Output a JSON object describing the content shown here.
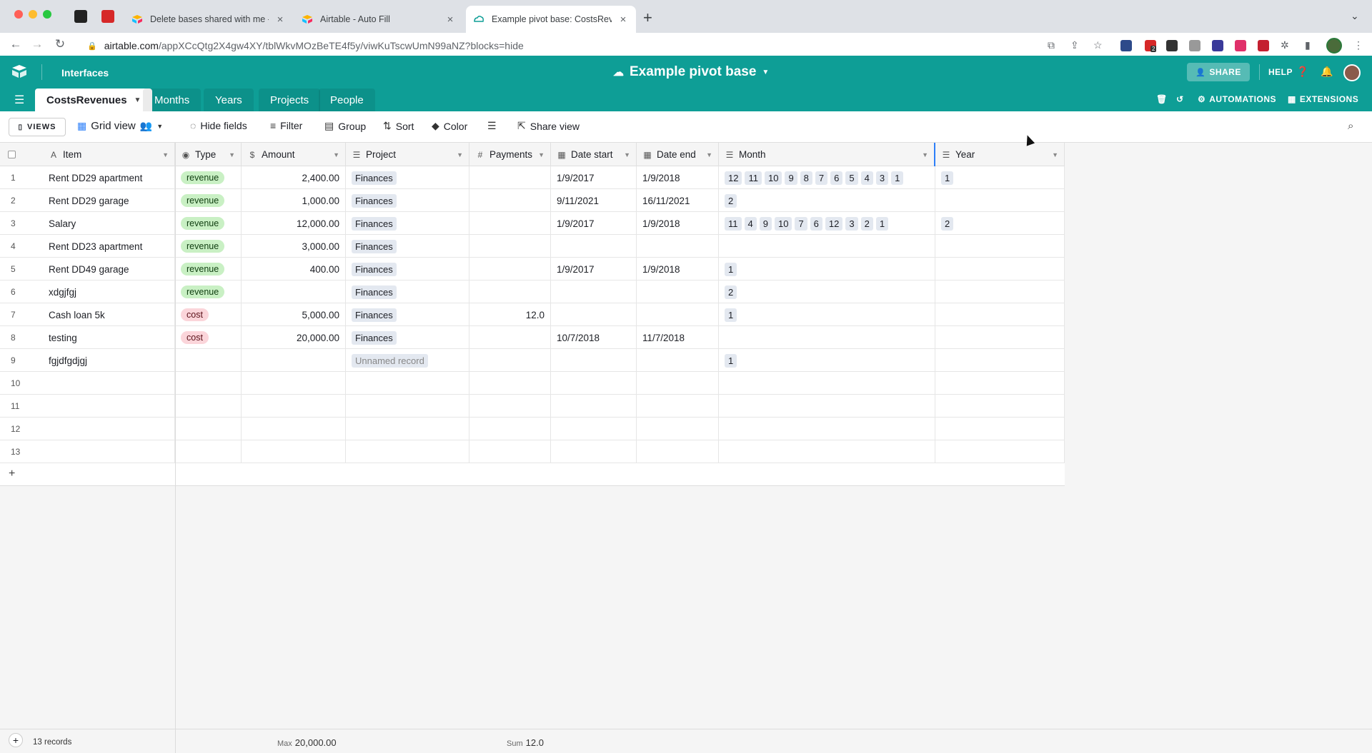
{
  "browser": {
    "tabs": [
      {
        "title": "Delete bases shared with me -",
        "active": false
      },
      {
        "title": "Airtable - Auto Fill",
        "active": false
      },
      {
        "title": "Example pivot base: CostsReve",
        "active": true
      }
    ],
    "url_host": "airtable.com",
    "url_path": "/appXCcQtg2X4gw4XY/tblWkvMOzBeTE4f5y/viwKuTscwUmN99aNZ?blocks=hide",
    "ext_badge": "2"
  },
  "header": {
    "interfaces": "Interfaces",
    "base_title": "Example pivot base",
    "share": "SHARE",
    "help": "HELP"
  },
  "tables": [
    "CostsRevenues",
    "Months",
    "Years",
    "Projects",
    "People"
  ],
  "tablebar_right": {
    "automations": "AUTOMATIONS",
    "extensions": "EXTENSIONS"
  },
  "toolbar": {
    "views": "VIEWS",
    "grid_view": "Grid view",
    "hide_fields": "Hide fields",
    "filter": "Filter",
    "group": "Group",
    "sort": "Sort",
    "color": "Color",
    "share_view": "Share view"
  },
  "columns": {
    "item": "Item",
    "type": "Type",
    "amount": "Amount",
    "project": "Project",
    "payments": "Payments",
    "date_start": "Date start",
    "date_end": "Date end",
    "month": "Month",
    "year": "Year"
  },
  "rows": [
    {
      "n": "1",
      "item": "Rent DD29 apartment",
      "type": "revenue",
      "amount": "2,400.00",
      "project": "Finances",
      "payments": "",
      "date_start": "1/9/2017",
      "date_end": "1/9/2018",
      "month": [
        "12",
        "11",
        "10",
        "9",
        "8",
        "7",
        "6",
        "5",
        "4",
        "3",
        "1"
      ],
      "year": [
        "1"
      ]
    },
    {
      "n": "2",
      "item": "Rent DD29 garage",
      "type": "revenue",
      "amount": "1,000.00",
      "project": "Finances",
      "payments": "",
      "date_start": "9/11/2021",
      "date_end": "16/11/2021",
      "month": [
        "2"
      ],
      "year": []
    },
    {
      "n": "3",
      "item": "Salary",
      "type": "revenue",
      "amount": "12,000.00",
      "project": "Finances",
      "payments": "",
      "date_start": "1/9/2017",
      "date_end": "1/9/2018",
      "month": [
        "11",
        "4",
        "9",
        "10",
        "7",
        "6",
        "12",
        "3",
        "2",
        "1"
      ],
      "year": [
        "2"
      ]
    },
    {
      "n": "4",
      "item": "Rent DD23 apartment",
      "type": "revenue",
      "amount": "3,000.00",
      "project": "Finances",
      "payments": "",
      "date_start": "",
      "date_end": "",
      "month": [],
      "year": []
    },
    {
      "n": "5",
      "item": "Rent DD49 garage",
      "type": "revenue",
      "amount": "400.00",
      "project": "Finances",
      "payments": "",
      "date_start": "1/9/2017",
      "date_end": "1/9/2018",
      "month": [
        "1"
      ],
      "year": []
    },
    {
      "n": "6",
      "item": "xdgjfgj",
      "type": "revenue",
      "amount": "",
      "project": "Finances",
      "payments": "",
      "date_start": "",
      "date_end": "",
      "month": [
        "2"
      ],
      "year": []
    },
    {
      "n": "7",
      "item": "Cash loan 5k",
      "type": "cost",
      "amount": "5,000.00",
      "project": "Finances",
      "payments": "12.0",
      "date_start": "",
      "date_end": "",
      "month": [
        "1"
      ],
      "year": []
    },
    {
      "n": "8",
      "item": "testing",
      "type": "cost",
      "amount": "20,000.00",
      "project": "Finances",
      "payments": "",
      "date_start": "10/7/2018",
      "date_end": "11/7/2018",
      "month": [],
      "year": []
    },
    {
      "n": "9",
      "item": "fgjdfgdjgj",
      "type": "",
      "amount": "",
      "project": "Unnamed record",
      "payments": "",
      "date_start": "",
      "date_end": "",
      "month": [
        "1"
      ],
      "year": []
    },
    {
      "n": "10",
      "item": "",
      "type": "",
      "amount": "",
      "project": "",
      "payments": "",
      "date_start": "",
      "date_end": "",
      "month": [],
      "year": []
    },
    {
      "n": "11",
      "item": "",
      "type": "",
      "amount": "",
      "project": "",
      "payments": "",
      "date_start": "",
      "date_end": "",
      "month": [],
      "year": []
    },
    {
      "n": "12",
      "item": "",
      "type": "",
      "amount": "",
      "project": "",
      "payments": "",
      "date_start": "",
      "date_end": "",
      "month": [],
      "year": []
    },
    {
      "n": "13",
      "item": "",
      "type": "",
      "amount": "",
      "project": "",
      "payments": "",
      "date_start": "",
      "date_end": "",
      "month": [],
      "year": []
    }
  ],
  "footer": {
    "record_count": "13 records",
    "amount_label": "Max",
    "amount_value": "20,000.00",
    "payments_label": "Sum",
    "payments_value": "12.0"
  },
  "colors": {
    "accent": "#0e9e96",
    "revenue_pill": "#c9f0c4",
    "cost_pill": "#fbd5da"
  }
}
